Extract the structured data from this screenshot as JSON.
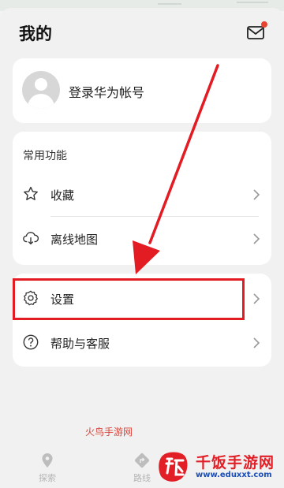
{
  "header": {
    "title": "我的"
  },
  "profile": {
    "login_text": "登录华为帐号"
  },
  "common": {
    "section_title": "常用功能",
    "items": [
      {
        "label": "收藏",
        "icon": "star-icon"
      },
      {
        "label": "离线地图",
        "icon": "cloud-download-icon"
      }
    ]
  },
  "settings_group": {
    "items": [
      {
        "label": "设置",
        "icon": "gear-icon"
      },
      {
        "label": "帮助与客服",
        "icon": "help-icon"
      }
    ]
  },
  "tabs": [
    {
      "label": "探索",
      "icon": "location-pin-icon"
    },
    {
      "label": "路线",
      "icon": "route-icon"
    }
  ],
  "watermarks": {
    "small": "火鸟手游网",
    "brand_name": "千饭手游网",
    "brand_url": "www.eduxxt.com"
  },
  "colors": {
    "highlight": "#e31b23",
    "badge": "#e8432e",
    "brand_blue": "#1c4fb6"
  }
}
